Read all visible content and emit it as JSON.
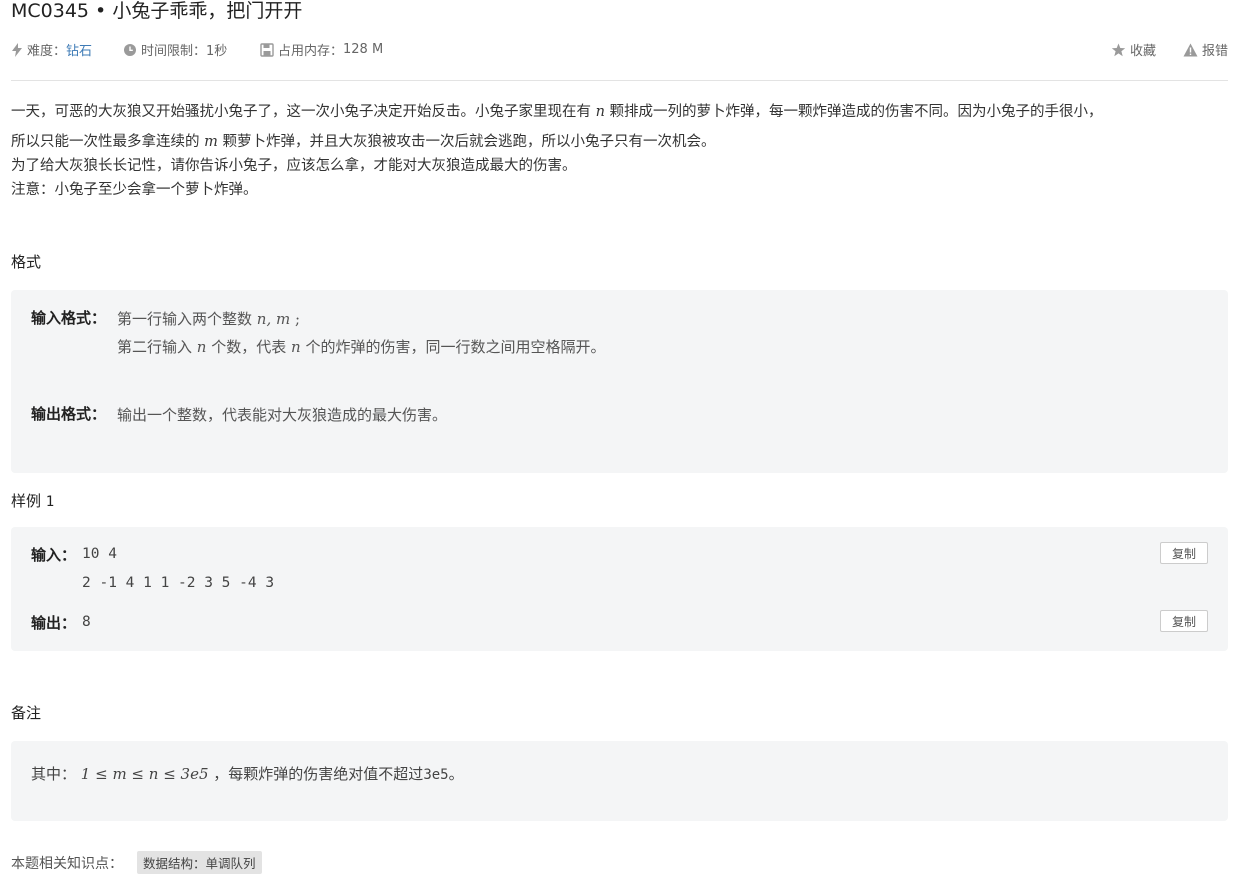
{
  "problem": {
    "id": "MC0345",
    "separator": " • ",
    "name": "小兔子乖乖，把门开开"
  },
  "meta": {
    "difficulty_label": "难度：",
    "difficulty_value": "钻石",
    "time_limit_label": "时间限制：",
    "time_limit_value": "1秒",
    "memory_label": "占用内存：",
    "memory_value": "128 M",
    "favorite_label": "收藏",
    "report_label": "报错"
  },
  "description": {
    "line1_a": "一天，可恶的大灰狼又开始骚扰小兔子了，这一次小兔子决定开始反击。小兔子家里现在有 ",
    "line1_var": "n",
    "line1_b": " 颗排成一列的萝卜炸弹，每一颗炸弹造成的伤害不同。因为小兔子的手很小，",
    "line2_a": "所以只能一次性最多拿连续的 ",
    "line2_var": "m",
    "line2_b": " 颗萝卜炸弹，并且大灰狼被攻击一次后就会逃跑，所以小兔子只有一次机会。",
    "line3": "为了给大灰狼长长记性，请你告诉小兔子，应该怎么拿，才能对大灰狼造成最大的伤害。",
    "line4": "注意：小兔子至少会拿一个萝卜炸弹。"
  },
  "format": {
    "section_title": "格式",
    "input_label": "输入格式：",
    "input_line1_a": "第一行输入两个整数 ",
    "input_line1_var": "n, m",
    "input_line1_b": " ;",
    "input_line2_a": "第二行输入 ",
    "input_line2_var1": "n",
    "input_line2_b": " 个数，代表 ",
    "input_line2_var2": "n",
    "input_line2_c": " 个的炸弹的伤害，同一行数之间用空格隔开。",
    "output_label": "输出格式：",
    "output_text": "输出一个整数，代表能对大灰狼造成的最大伤害。"
  },
  "sample": {
    "section_title": "样例",
    "section_index": "1",
    "input_label": "输入：",
    "input_line1": "10 4",
    "input_line2": "2 -1 4 1 1 -2 3 5 -4 3",
    "output_label": "输出：",
    "output_value": "8",
    "copy_label": "复制"
  },
  "notes": {
    "section_title": "备注",
    "prefix": "其中：",
    "math": "1 ≤ m ≤ n ≤ 3e5",
    "suffix": "，每颗炸弹的伤害绝对值不超过",
    "limit": "3e5",
    "end": "。"
  },
  "knowledge": {
    "label": "本题相关知识点：",
    "tags": [
      "数据结构：单调队列"
    ]
  },
  "colors": {
    "accent": "#3e7bb6",
    "panel_bg": "#f4f5f6",
    "divider": "#e3e3e3"
  }
}
